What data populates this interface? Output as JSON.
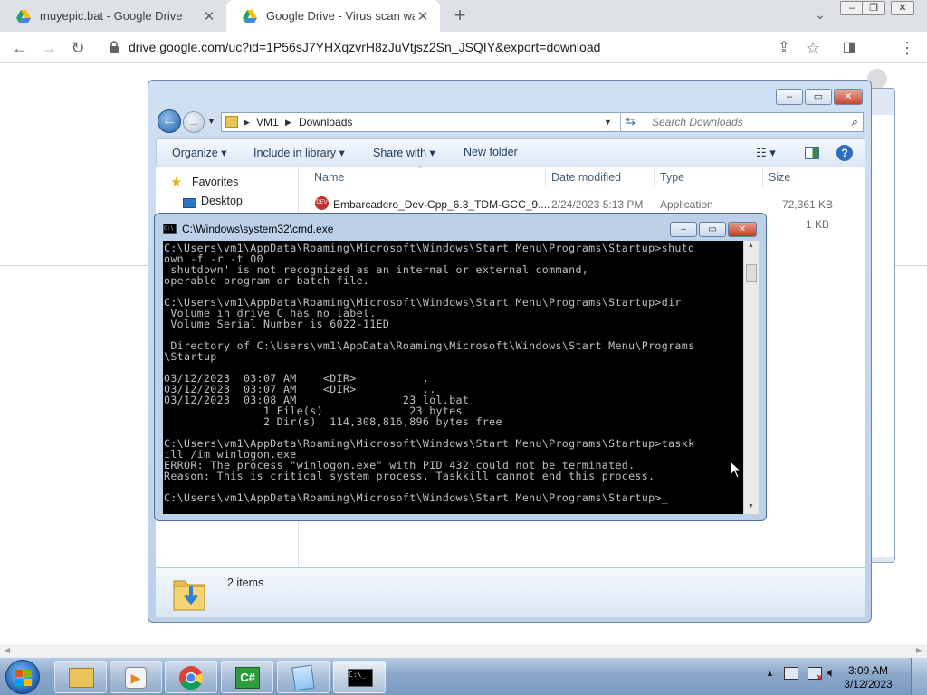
{
  "browser": {
    "tabs": [
      {
        "title": "muyepic.bat - Google Drive",
        "active": false
      },
      {
        "title": "Google Drive - Virus scan warnin",
        "active": true
      }
    ],
    "new_tab": "+",
    "url": "drive.google.com/uc?id=1P56sJ7YHXqzvrH8zJuVtjsz2Sn_JSQIY&export=download"
  },
  "explorer": {
    "breadcrumb": [
      "VM1",
      "Downloads"
    ],
    "search_placeholder": "Search Downloads",
    "commands": [
      "Organize",
      "Include in library",
      "Share with",
      "New folder"
    ],
    "nav": {
      "favorites": "Favorites",
      "desktop": "Desktop"
    },
    "columns": [
      "Name",
      "Date modified",
      "Type",
      "Size"
    ],
    "files": [
      {
        "name": "Embarcadero_Dev-Cpp_6.3_TDM-GCC_9....",
        "date": "2/24/2023 5:13 PM",
        "type": "Application",
        "size": "72,361 KB"
      },
      {
        "name": "",
        "date": "",
        "type": "",
        "size": "1 KB"
      }
    ],
    "status": "2 items"
  },
  "cmd": {
    "title": "C:\\Windows\\system32\\cmd.exe",
    "console": "C:\\Users\\vm1\\AppData\\Roaming\\Microsoft\\Windows\\Start Menu\\Programs\\Startup>shutd\nown -f -r -t 00\n'shutdown' is not recognized as an internal or external command,\noperable program or batch file.\n\nC:\\Users\\vm1\\AppData\\Roaming\\Microsoft\\Windows\\Start Menu\\Programs\\Startup>dir\n Volume in drive C has no label.\n Volume Serial Number is 6022-11ED\n\n Directory of C:\\Users\\vm1\\AppData\\Roaming\\Microsoft\\Windows\\Start Menu\\Programs\n\\Startup\n\n03/12/2023  03:07 AM    <DIR>          .\n03/12/2023  03:07 AM    <DIR>          ..\n03/12/2023  03:08 AM                23 lol.bat\n               1 File(s)             23 bytes\n               2 Dir(s)  114,308,816,896 bytes free\n\nC:\\Users\\vm1\\AppData\\Roaming\\Microsoft\\Windows\\Start Menu\\Programs\\Startup>taskk\nill /im winlogon.exe\nERROR: The process \"winlogon.exe\" with PID 432 could not be terminated.\nReason: This is critical system process. Taskkill cannot end this process.\n\nC:\\Users\\vm1\\AppData\\Roaming\\Microsoft\\Windows\\Start Menu\\Programs\\Startup>_"
  },
  "taskbar": {
    "apps": [
      "explorer-icon",
      "media-player-icon",
      "chrome-icon",
      "csharp-icon",
      "notepad-icon",
      "cmd-icon"
    ],
    "time": "3:09 AM",
    "date": "3/12/2023"
  }
}
